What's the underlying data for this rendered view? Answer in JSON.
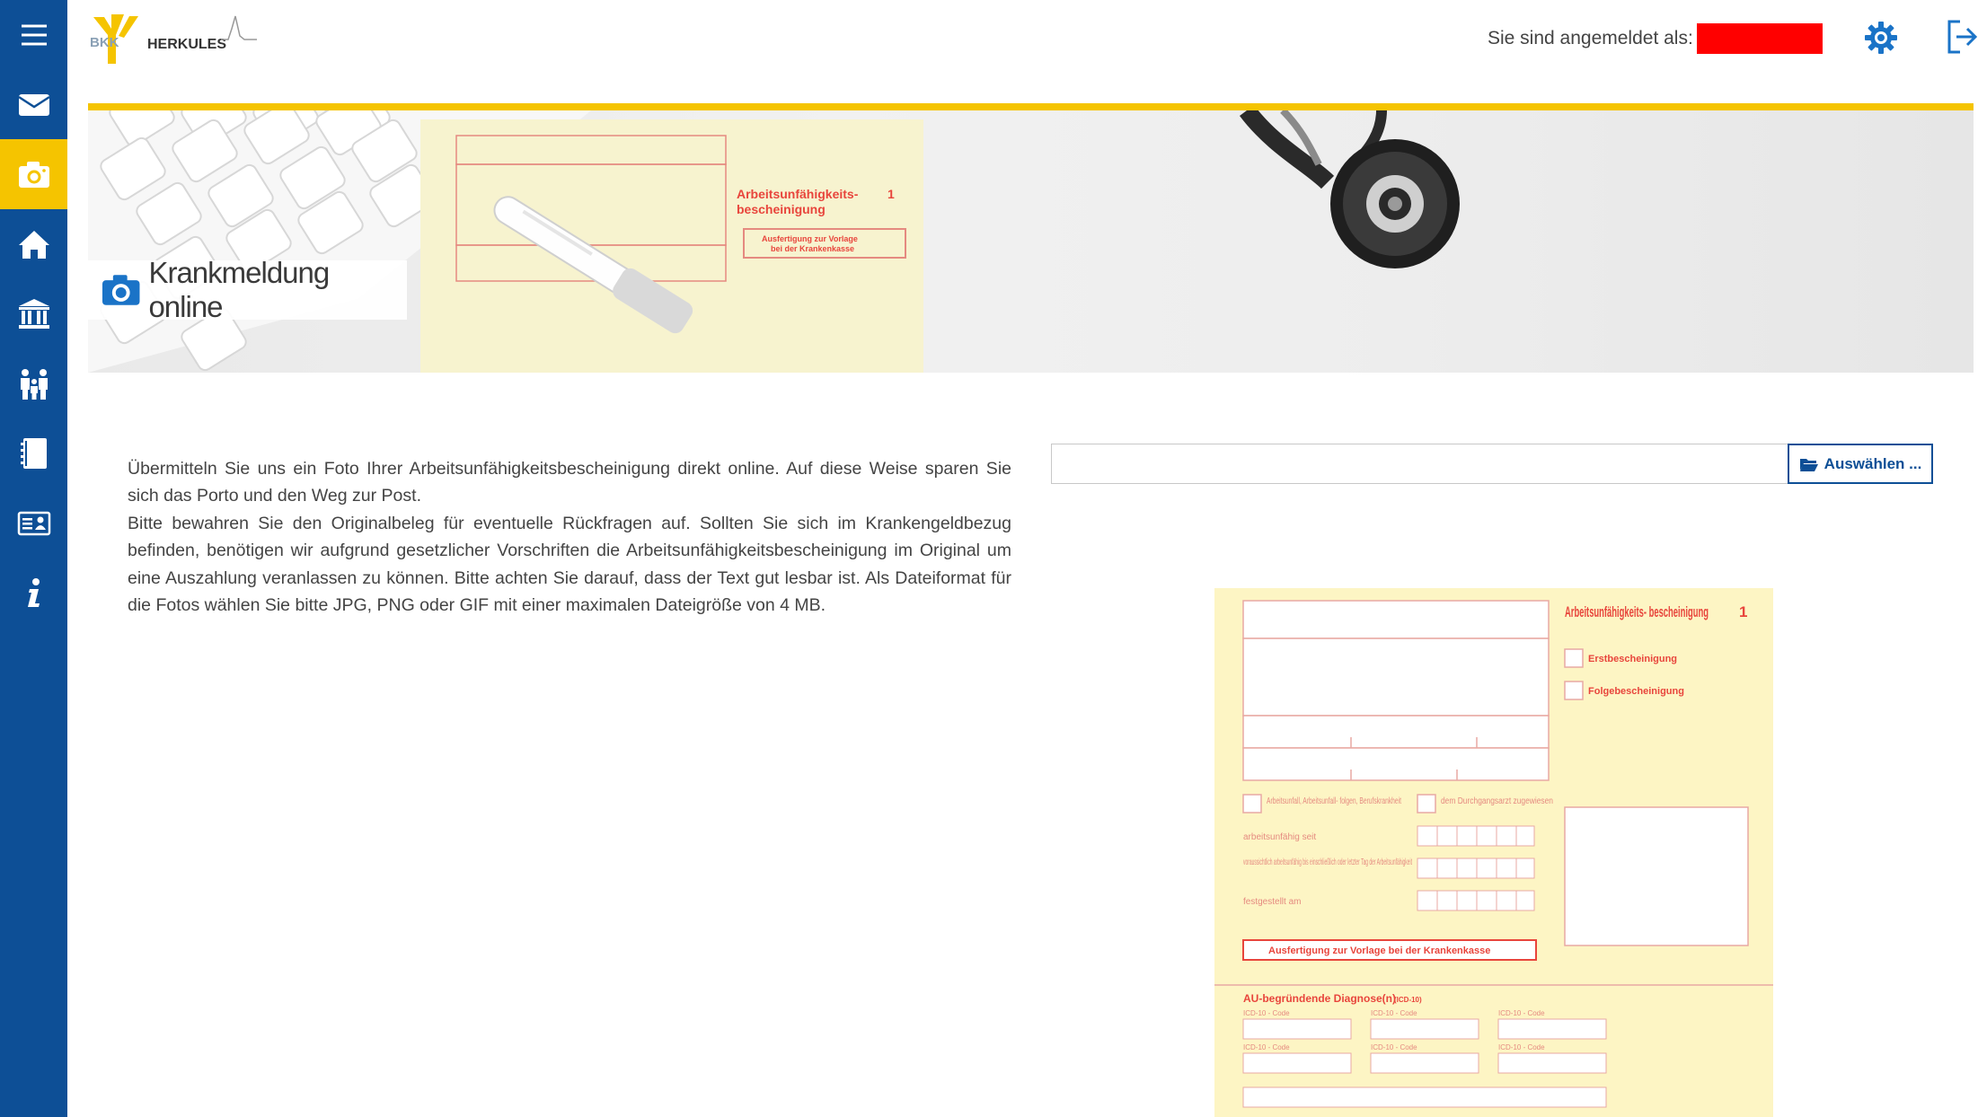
{
  "app": {
    "logo_text_bkk": "BKK",
    "logo_text_name": "HERKULES"
  },
  "header": {
    "logged_in_label": "Sie sind angemeldet als:"
  },
  "sidebar": {
    "items": [
      {
        "icon": "menu-icon"
      },
      {
        "icon": "mail-icon"
      },
      {
        "icon": "camera-icon",
        "active": true
      },
      {
        "icon": "home-icon"
      },
      {
        "icon": "bank-icon"
      },
      {
        "icon": "family-icon"
      },
      {
        "icon": "notebook-icon"
      },
      {
        "icon": "id-card-icon"
      },
      {
        "icon": "info-icon"
      }
    ]
  },
  "banner": {
    "title": "Krankmeldung online",
    "bg_form_title": "Arbeitsunfähigkeits- bescheinigung",
    "bg_form_number": "1",
    "bg_form_stamp": "Ausfertigung zur Vorlage bei der Krankenkasse"
  },
  "content": {
    "paragraph_1": "Übermitteln Sie uns ein Foto Ihrer Arbeitsunfähigkeitsbescheinigung direkt online. Auf diese Weise sparen Sie sich das Porto und den Weg zur Post.",
    "paragraph_2": "Bitte bewahren Sie den Originalbeleg für eventuelle Rückfragen auf. Sollten Sie sich im Krankengeldbezug befinden, benötigen wir aufgrund gesetzlicher Vorschriften die Arbeitsunfähigkeitsbescheinigung im Original um eine Auszahlung veranlassen zu können. Bitte achten Sie darauf, dass der Text gut lesbar ist. Als Dateiformat für die Fotos wählen Sie bitte JPG, PNG oder GIF mit einer maximalen Dateigröße von 4 MB."
  },
  "upload": {
    "value": "",
    "button_label": "Auswählen ..."
  },
  "sample_form": {
    "title": "Arbeitsunfähigkeits- bescheinigung",
    "number": "1",
    "option_first": "Erstbescheinigung",
    "option_followup": "Folgebescheinigung",
    "accident_label": "Arbeitsunfall, Arbeitsunfall- folgen, Berufskrankheit",
    "transit_label": "dem Durchgangsarzt zugewiesen",
    "since_label": "arbeitsunfähig seit",
    "until_label": "voraussichtlich arbeitsunfähig bis einschließlich oder letzter Tag der Arbeitsunfähigkeit",
    "determined_label": "festgestellt am",
    "stamp_label": "Ausfertigung zur Vorlage bei der Krankenkasse",
    "diagnosis_label": "AU-begründende Diagnose(n)",
    "diagnosis_suffix": "(ICD-10)",
    "icd_code_label": "ICD-10 - Code"
  },
  "colors": {
    "sidebar_bg": "#0d4f96",
    "accent_yellow": "#f5c400",
    "form_red": "#e8453c",
    "form_bg": "#fdf5c4"
  }
}
